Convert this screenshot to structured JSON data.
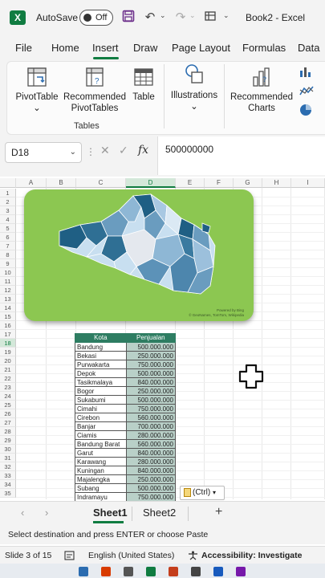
{
  "titlebar": {
    "app_glyph": "X",
    "autosave_label": "AutoSave",
    "autosave_state": "Off",
    "workbook_title": "Book2  -  Excel",
    "icons": [
      "excel-logo-icon",
      "save-icon",
      "undo-icon",
      "redo-icon",
      "quick-access-icon"
    ]
  },
  "ribbon_tabs": [
    "File",
    "Home",
    "Insert",
    "Draw",
    "Page Layout",
    "Formulas",
    "Data"
  ],
  "active_tab": "Insert",
  "ribbon": {
    "pivottable": "PivotTable",
    "recommended_pivottables_1": "Recommended",
    "recommended_pivottables_2": "PivotTables",
    "table": "Table",
    "illustrations": "Illustrations",
    "recommended_charts_1": "Recommended",
    "recommended_charts_2": "Charts",
    "group_tables": "Tables",
    "dropdown_glyph": "⌄"
  },
  "formula_bar": {
    "name_box": "D18",
    "formula": "500000000",
    "fx": "fx",
    "cancel": "✕",
    "enter": "✓"
  },
  "columns": [
    "A",
    "B",
    "C",
    "D",
    "E",
    "F",
    "G",
    "H",
    "I"
  ],
  "selected_column": "D",
  "rows": [
    "1",
    "2",
    "3",
    "4",
    "5",
    "6",
    "7",
    "8",
    "9",
    "10",
    "11",
    "12",
    "13",
    "14",
    "15",
    "16",
    "17",
    "18",
    "19",
    "20",
    "21",
    "22",
    "23",
    "24",
    "25",
    "26",
    "27",
    "28",
    "29",
    "30",
    "31",
    "32",
    "33",
    "34",
    "35"
  ],
  "selected_row": "18",
  "map": {
    "credit_1": "Powered by Bing",
    "credit_2": "© GeoNames, TomTom, Wikipedia"
  },
  "table": {
    "headers": [
      "Kota",
      "Penjualan"
    ],
    "rows": [
      [
        "Bandung",
        "500.000.000"
      ],
      [
        "Bekasi",
        "250.000.000"
      ],
      [
        "Purwakarta",
        "750.000.000"
      ],
      [
        "Depok",
        "500.000.000"
      ],
      [
        "Tasikmalaya",
        "840.000.000"
      ],
      [
        "Bogor",
        "250.000.000"
      ],
      [
        "Sukabumi",
        "500.000.000"
      ],
      [
        "Cimahi",
        "750.000.000"
      ],
      [
        "Cirebon",
        "560.000.000"
      ],
      [
        "Banjar",
        "700.000.000"
      ],
      [
        "Ciamis",
        "280.000.000"
      ],
      [
        "Bandung Barat",
        "560.000.000"
      ],
      [
        "Garut",
        "840.000.000"
      ],
      [
        "Karawang",
        "280.000.000"
      ],
      [
        "Kuningan",
        "840.000.000"
      ],
      [
        "Majalengka",
        "250.000.000"
      ],
      [
        "Subang",
        "500.000.000"
      ],
      [
        "Indramayu",
        "750.000.000"
      ]
    ]
  },
  "paste_options": "(Ctrl)",
  "sheets": [
    "Sheet1",
    "Sheet2"
  ],
  "active_sheet": "Sheet1",
  "status_message": "Select destination and press ENTER or choose Paste",
  "footer": {
    "slide": "Slide 3 of 15",
    "language": "English (United States)",
    "accessibility": "Accessibility: Investigate"
  },
  "colors": {
    "accent": "#107c41",
    "map_background": "#8cc751",
    "region_dark": "#1f5f84",
    "region_mid": "#6a9cbf",
    "region_light": "#c8dff0",
    "header_fill": "#2e7d62",
    "value_fill": "#b9d0c8"
  }
}
